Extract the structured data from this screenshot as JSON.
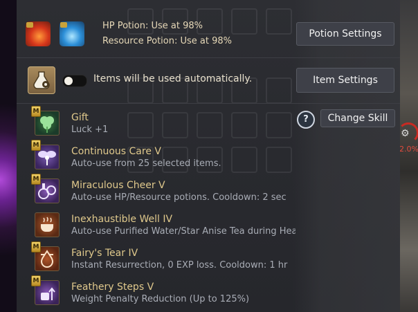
{
  "potion": {
    "hp_label": "HP Potion: Use at 98%",
    "resource_label": "Resource Potion: Use at 98%",
    "settings_button": "Potion Settings"
  },
  "auto_use": {
    "status_text": "Items will be used automatically.",
    "toggle_state": "off",
    "settings_button": "Item Settings"
  },
  "change_skill": {
    "help_icon": "?",
    "button": "Change Skill"
  },
  "skills": [
    {
      "badge": "M",
      "name": "Gift",
      "desc": "Luck +1",
      "icon": "clover-icon"
    },
    {
      "badge": "M",
      "name": "Continuous Care V",
      "desc": "Auto-use from 25 selected items.",
      "icon": "fairy-icon"
    },
    {
      "badge": "M",
      "name": "Miraculous Cheer V",
      "desc": "Auto-use HP/Resource potions. Cooldown: 2 sec",
      "icon": "potion-flasks-icon"
    },
    {
      "badge": "",
      "name": "Inexhaustible Well IV",
      "desc": "Auto-use Purified Water/Star Anise Tea during Heatstrok...",
      "icon": "teacup-icon"
    },
    {
      "badge": "M",
      "name": "Fairy's Tear IV",
      "desc": "Instant Resurrection, 0 EXP loss. Cooldown: 1 hr",
      "icon": "tear-icon"
    },
    {
      "badge": "M",
      "name": "Feathery Steps V",
      "desc": "Weight Penalty Reduction (Up to 125%)",
      "icon": "weight-up-icon"
    }
  ],
  "side_indicator": {
    "percent_text": "2.0%"
  },
  "colors": {
    "panel": "#2b2c31",
    "gold_text": "#e0c98c",
    "desc_text": "#a9adb6",
    "button_bg": "#3e4048"
  }
}
